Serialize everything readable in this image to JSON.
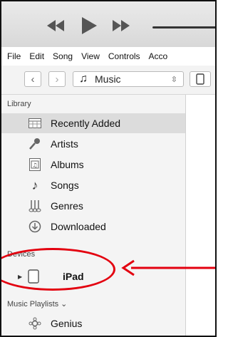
{
  "menu": [
    "File",
    "Edit",
    "Song",
    "View",
    "Controls",
    "Acco"
  ],
  "toolbar": {
    "media_kind": "Music",
    "back_icon": "chevron-left-icon",
    "forward_icon": "chevron-right-icon"
  },
  "sidebar": {
    "library_heading": "Library",
    "library_items": [
      {
        "label": "Recently Added",
        "icon": "recently-added-icon",
        "selected": true
      },
      {
        "label": "Artists",
        "icon": "microphone-icon"
      },
      {
        "label": "Albums",
        "icon": "album-icon"
      },
      {
        "label": "Songs",
        "icon": "music-note-icon"
      },
      {
        "label": "Genres",
        "icon": "genres-icon"
      },
      {
        "label": "Downloaded",
        "icon": "download-icon"
      }
    ],
    "devices_heading": "Devices",
    "device": {
      "label": "iPad",
      "icon": "ipad-icon"
    },
    "playlists_heading": "Music Playlists ⌄",
    "playlists": [
      {
        "label": "Genius",
        "icon": "genius-icon"
      }
    ]
  },
  "colors": {
    "annotation": "#e3000f",
    "selected_row": "#dcdcdc",
    "sidebar_bg": "#f4f4f4"
  }
}
